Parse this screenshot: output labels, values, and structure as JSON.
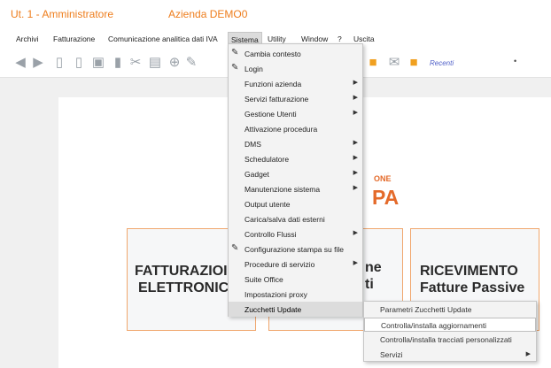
{
  "title": {
    "user": "Ut. 1 - Amministratore",
    "company": "Azienda DEMO0"
  },
  "menubar": [
    "Archivi",
    "Fatturazione",
    "Comunicazione analitica dati IVA",
    "Sistema",
    "Utility",
    "Window",
    "?",
    "Uscita"
  ],
  "toolbar": {
    "recent_label": "Recenti",
    "dropdown_arrow": "•"
  },
  "dropdown": [
    {
      "label": "Cambia contesto",
      "icon": "wrench-icon",
      "submenu": false
    },
    {
      "label": "Login",
      "icon": "wrench-icon",
      "submenu": false
    },
    {
      "label": "Funzioni azienda",
      "submenu": true
    },
    {
      "label": "Servizi fatturazione",
      "submenu": true
    },
    {
      "label": "Gestione Utenti",
      "submenu": true
    },
    {
      "label": "Attivazione procedura",
      "submenu": false
    },
    {
      "label": "DMS",
      "submenu": true
    },
    {
      "label": "Schedulatore",
      "submenu": true
    },
    {
      "label": "Gadget",
      "submenu": true
    },
    {
      "label": "Manutenzione sistema",
      "submenu": true
    },
    {
      "label": "Output utente",
      "submenu": false
    },
    {
      "label": "Carica/salva dati esterni",
      "submenu": false
    },
    {
      "label": "Controllo Flussi",
      "submenu": true
    },
    {
      "label": "Configurazione stampa su file",
      "icon": "wrench-icon",
      "submenu": false
    },
    {
      "label": "Procedure di servizio",
      "submenu": true
    },
    {
      "label": "Suite Office",
      "submenu": false
    },
    {
      "label": "Impostazioni proxy",
      "submenu": false
    },
    {
      "label": "Zucchetti Update",
      "submenu": false,
      "active": true
    }
  ],
  "submenu": [
    {
      "label": "Parametri Zucchetti Update",
      "submenu": false
    },
    {
      "label": "Controlla/installa aggiornamenti",
      "submenu": false,
      "highlighted": true
    },
    {
      "label": "Controlla/installa tracciati personalizzati",
      "submenu": false
    },
    {
      "label": "Servizi",
      "submenu": true
    }
  ],
  "tiles": {
    "fatturazione": [
      "FATTURAZIOI",
      "ELETTRONIC"
    ],
    "middle": [
      "ne",
      "ti"
    ],
    "ricevimento": [
      "RICEVIMENTO",
      "Fatture Passive"
    ]
  },
  "logo": {
    "top": "ONE",
    "bottom": "PA"
  },
  "colors": {
    "accent": "#ee7d1c",
    "tile_border": "#f0a76e",
    "recent": "#5060c8"
  }
}
